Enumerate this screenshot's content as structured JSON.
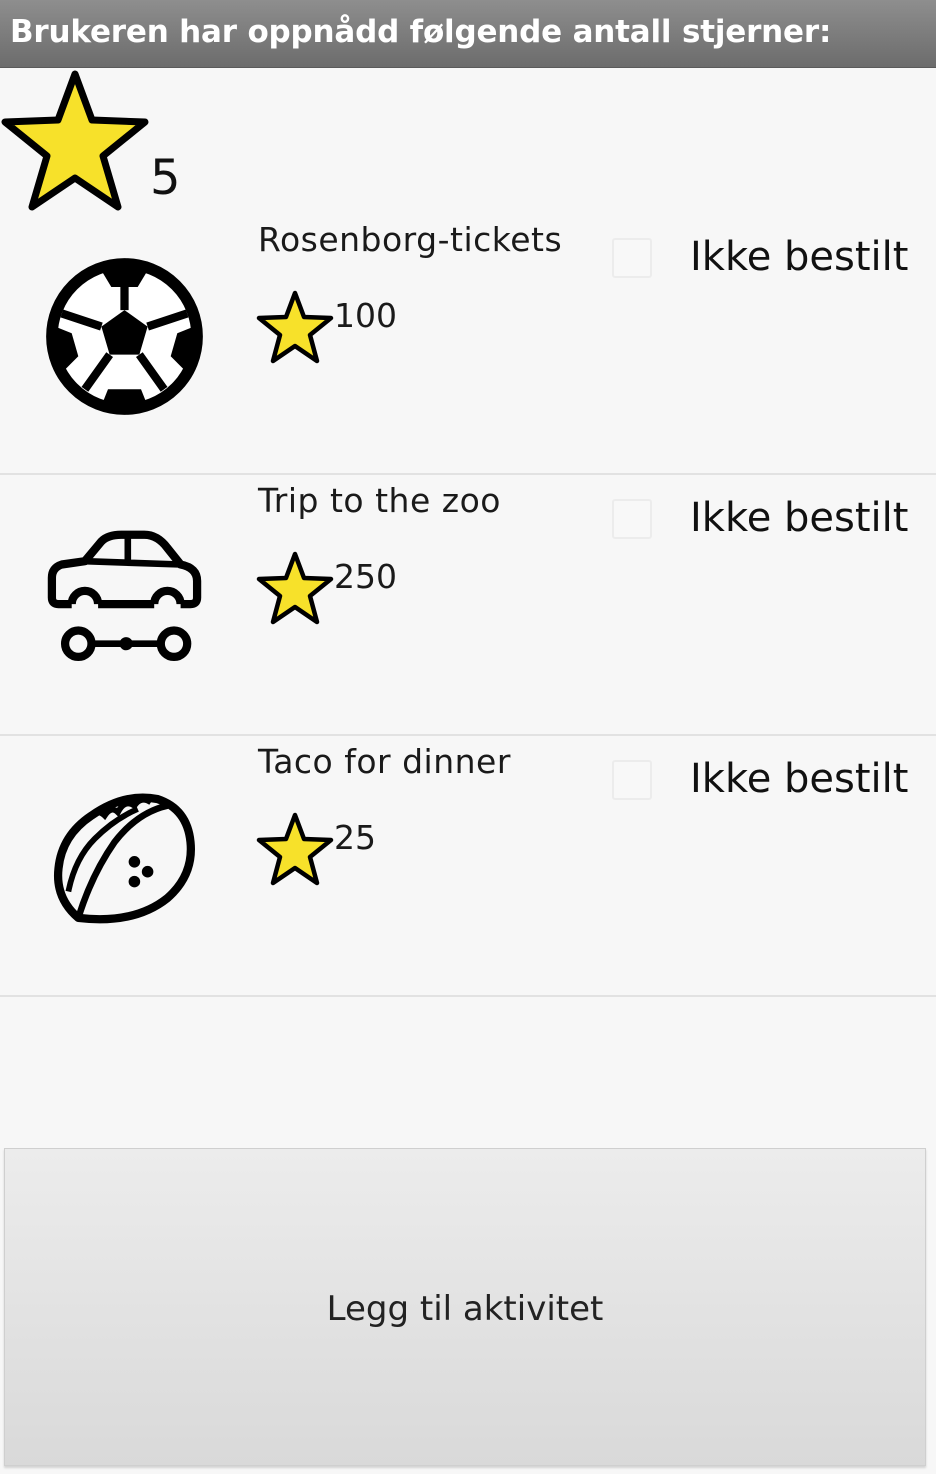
{
  "header": {
    "title": "Brukeren har oppnådd følgende antall stjerner:"
  },
  "stars": {
    "count": "5"
  },
  "activities": [
    {
      "name": "Rosenborg-tickets",
      "cost": "100",
      "status": "Ikke bestilt",
      "icon": "soccer-ball-icon",
      "checked": false
    },
    {
      "name": "Trip to the zoo",
      "cost": "250",
      "status": "Ikke bestilt",
      "icon": "car-icon",
      "checked": false
    },
    {
      "name": "Taco for dinner",
      "cost": "25",
      "status": "Ikke bestilt",
      "icon": "taco-icon",
      "checked": false
    }
  ],
  "footer": {
    "add_label": "Legg til aktivitet"
  },
  "colors": {
    "star_fill": "#f7e12a",
    "star_stroke": "#000000",
    "titlebar": "#7a7a7a"
  }
}
